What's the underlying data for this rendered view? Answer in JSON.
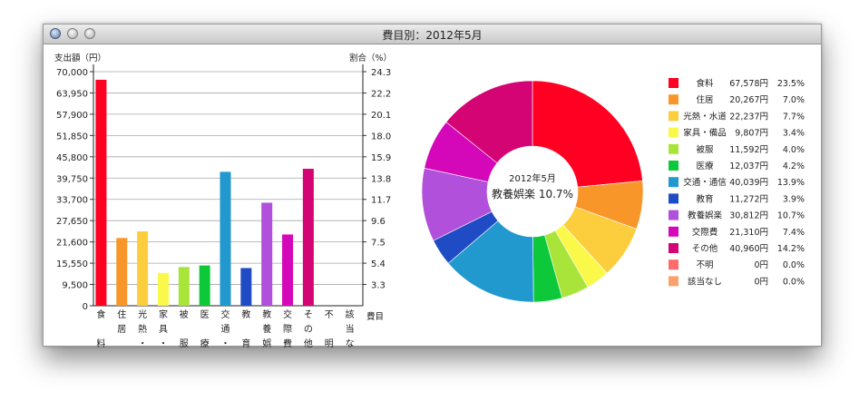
{
  "window": {
    "title": "費目別：2012年5月"
  },
  "chart_data": {
    "type": "bar",
    "ylabel_left": "支出額（円）",
    "ylabel_right": "割合（%）",
    "xlabel": "費目",
    "ylim": [
      0,
      70000
    ],
    "yticks_left": [
      "70,000",
      "63,950",
      "57,900",
      "51,850",
      "45,800",
      "39,750",
      "33,700",
      "27,650",
      "21,600",
      "15,550",
      "9,500",
      "0"
    ],
    "yticks_right": [
      "24.3",
      "22.2",
      "20.1",
      "18.0",
      "15.9",
      "13.8",
      "11.7",
      "9.6",
      "7.5",
      "5.4",
      "3.3"
    ],
    "categories": [
      {
        "name": "食料",
        "label_v": [
          "食",
          "",
          "料"
        ],
        "value": 67578,
        "amount": "67,578円",
        "percent": "23.5%",
        "color": "#ff0022"
      },
      {
        "name": "住居",
        "label_v": [
          "住",
          "居"
        ],
        "value": 20267,
        "amount": "20,267円",
        "percent": "7.0%",
        "color": "#f8962a"
      },
      {
        "name": "光熱・水道",
        "label_v": [
          "光",
          "熱",
          "・"
        ],
        "value": 22237,
        "amount": "22,237円",
        "percent": "7.7%",
        "color": "#fcce3d"
      },
      {
        "name": "家具・備品",
        "label_v": [
          "家",
          "具",
          "・"
        ],
        "value": 9807,
        "amount": "9,807円",
        "percent": "3.4%",
        "color": "#faf94a"
      },
      {
        "name": "被服",
        "label_v": [
          "被",
          "",
          "服"
        ],
        "value": 11592,
        "amount": "11,592円",
        "percent": "4.0%",
        "color": "#a9e43a"
      },
      {
        "name": "医療",
        "label_v": [
          "医",
          "",
          "療"
        ],
        "value": 12037,
        "amount": "12,037円",
        "percent": "4.2%",
        "color": "#0dc93a"
      },
      {
        "name": "交通・通信",
        "label_v": [
          "交",
          "通",
          "・"
        ],
        "value": 40039,
        "amount": "40,039円",
        "percent": "13.9%",
        "color": "#2199ce"
      },
      {
        "name": "教育",
        "label_v": [
          "教",
          "",
          "育"
        ],
        "value": 11272,
        "amount": "11,272円",
        "percent": "3.9%",
        "color": "#1f4cc4"
      },
      {
        "name": "教養娯楽",
        "label_v": [
          "教",
          "養",
          "娯"
        ],
        "value": 30812,
        "amount": "30,812円",
        "percent": "10.7%",
        "color": "#b150da"
      },
      {
        "name": "交際費",
        "label_v": [
          "交",
          "際",
          "費"
        ],
        "value": 21310,
        "amount": "21,310円",
        "percent": "7.4%",
        "color": "#d407b9"
      },
      {
        "name": "その他",
        "label_v": [
          "そ",
          "の",
          "他"
        ],
        "value": 40960,
        "amount": "40,960円",
        "percent": "14.2%",
        "color": "#d40475"
      },
      {
        "name": "不明",
        "label_v": [
          "不",
          "",
          "明"
        ],
        "value": 0,
        "amount": "0円",
        "percent": "0.0%",
        "color": "#ff6a6a"
      },
      {
        "name": "該当なし",
        "label_v": [
          "該",
          "当",
          "な"
        ],
        "value": 0,
        "amount": "0円",
        "percent": "0.0%",
        "color": "#fba26c"
      }
    ],
    "pie_center": {
      "line1": "2012年5月",
      "line2": "教養娯楽 10.7%"
    }
  }
}
